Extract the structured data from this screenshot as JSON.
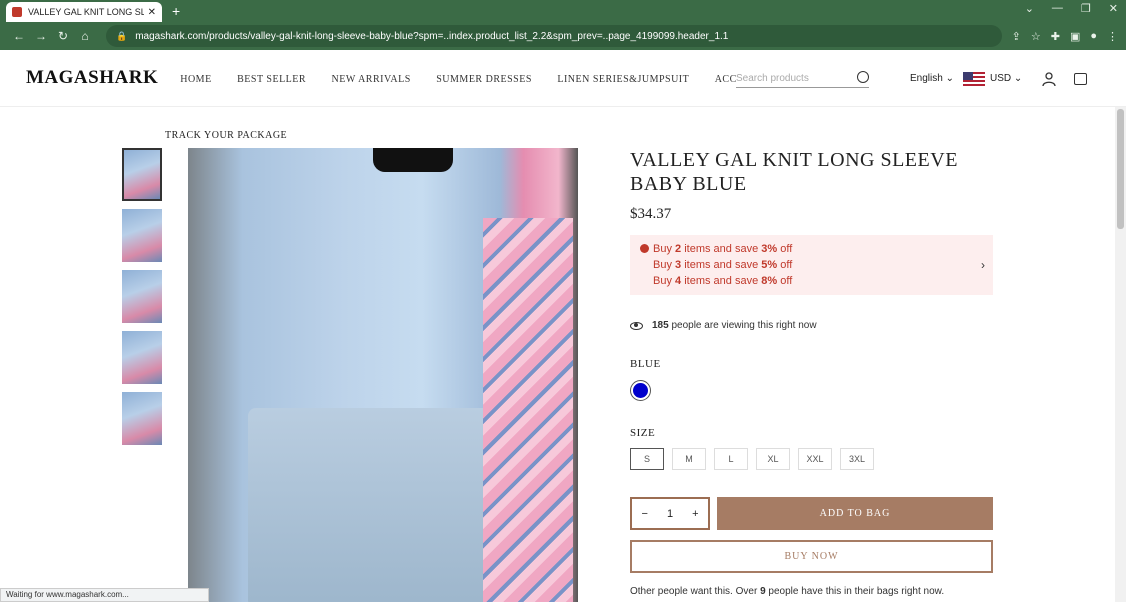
{
  "browser": {
    "tab_title": "VALLEY GAL KNIT LONG SLEEVE BABY BLUE",
    "tab_close": "✕",
    "new_tab": "+",
    "url": "magashark.com/products/valley-gal-knit-long-sleeve-baby-blue?spm=..index.product_list_2.2&spm_prev=..page_4199099.header_1.1",
    "status_text": "Waiting for www.magashark.com..."
  },
  "header": {
    "logo": "MAGASHARK",
    "nav": [
      "HOME",
      "BEST SELLER",
      "NEW ARRIVALS",
      "SUMMER DRESSES",
      "LINEN SERIES&JUMPSUIT",
      "ACC"
    ],
    "search_placeholder": "Search products",
    "language": "English",
    "currency": "USD"
  },
  "track_link": "TRACK YOUR PACKAGE",
  "product": {
    "title": "VALLEY GAL KNIT LONG SLEEVE BABY BLUE",
    "price": "$34.37",
    "promos": [
      {
        "buy": "Buy",
        "count": "2",
        "mid": "items and save",
        "pct": "3%",
        "end": "off"
      },
      {
        "buy": "Buy",
        "count": "3",
        "mid": "items and save",
        "pct": "5%",
        "end": "off"
      },
      {
        "buy": "Buy",
        "count": "4",
        "mid": "items and save",
        "pct": "8%",
        "end": "off"
      }
    ],
    "viewing_count": "185",
    "viewing_text": "people are viewing this right now",
    "color_label": "BLUE",
    "swatch_color": "#0000cc",
    "size_label": "SIZE",
    "sizes": [
      "S",
      "M",
      "L",
      "XL",
      "XXL",
      "3XL"
    ],
    "quantity": "1",
    "qty_minus": "−",
    "qty_plus": "+",
    "add_to_bag": "ADD TO BAG",
    "buy_now": "BUY NOW",
    "others_pre": "Other people want this. Over",
    "others_count": "9",
    "others_post": "people have this in their bags right now."
  }
}
